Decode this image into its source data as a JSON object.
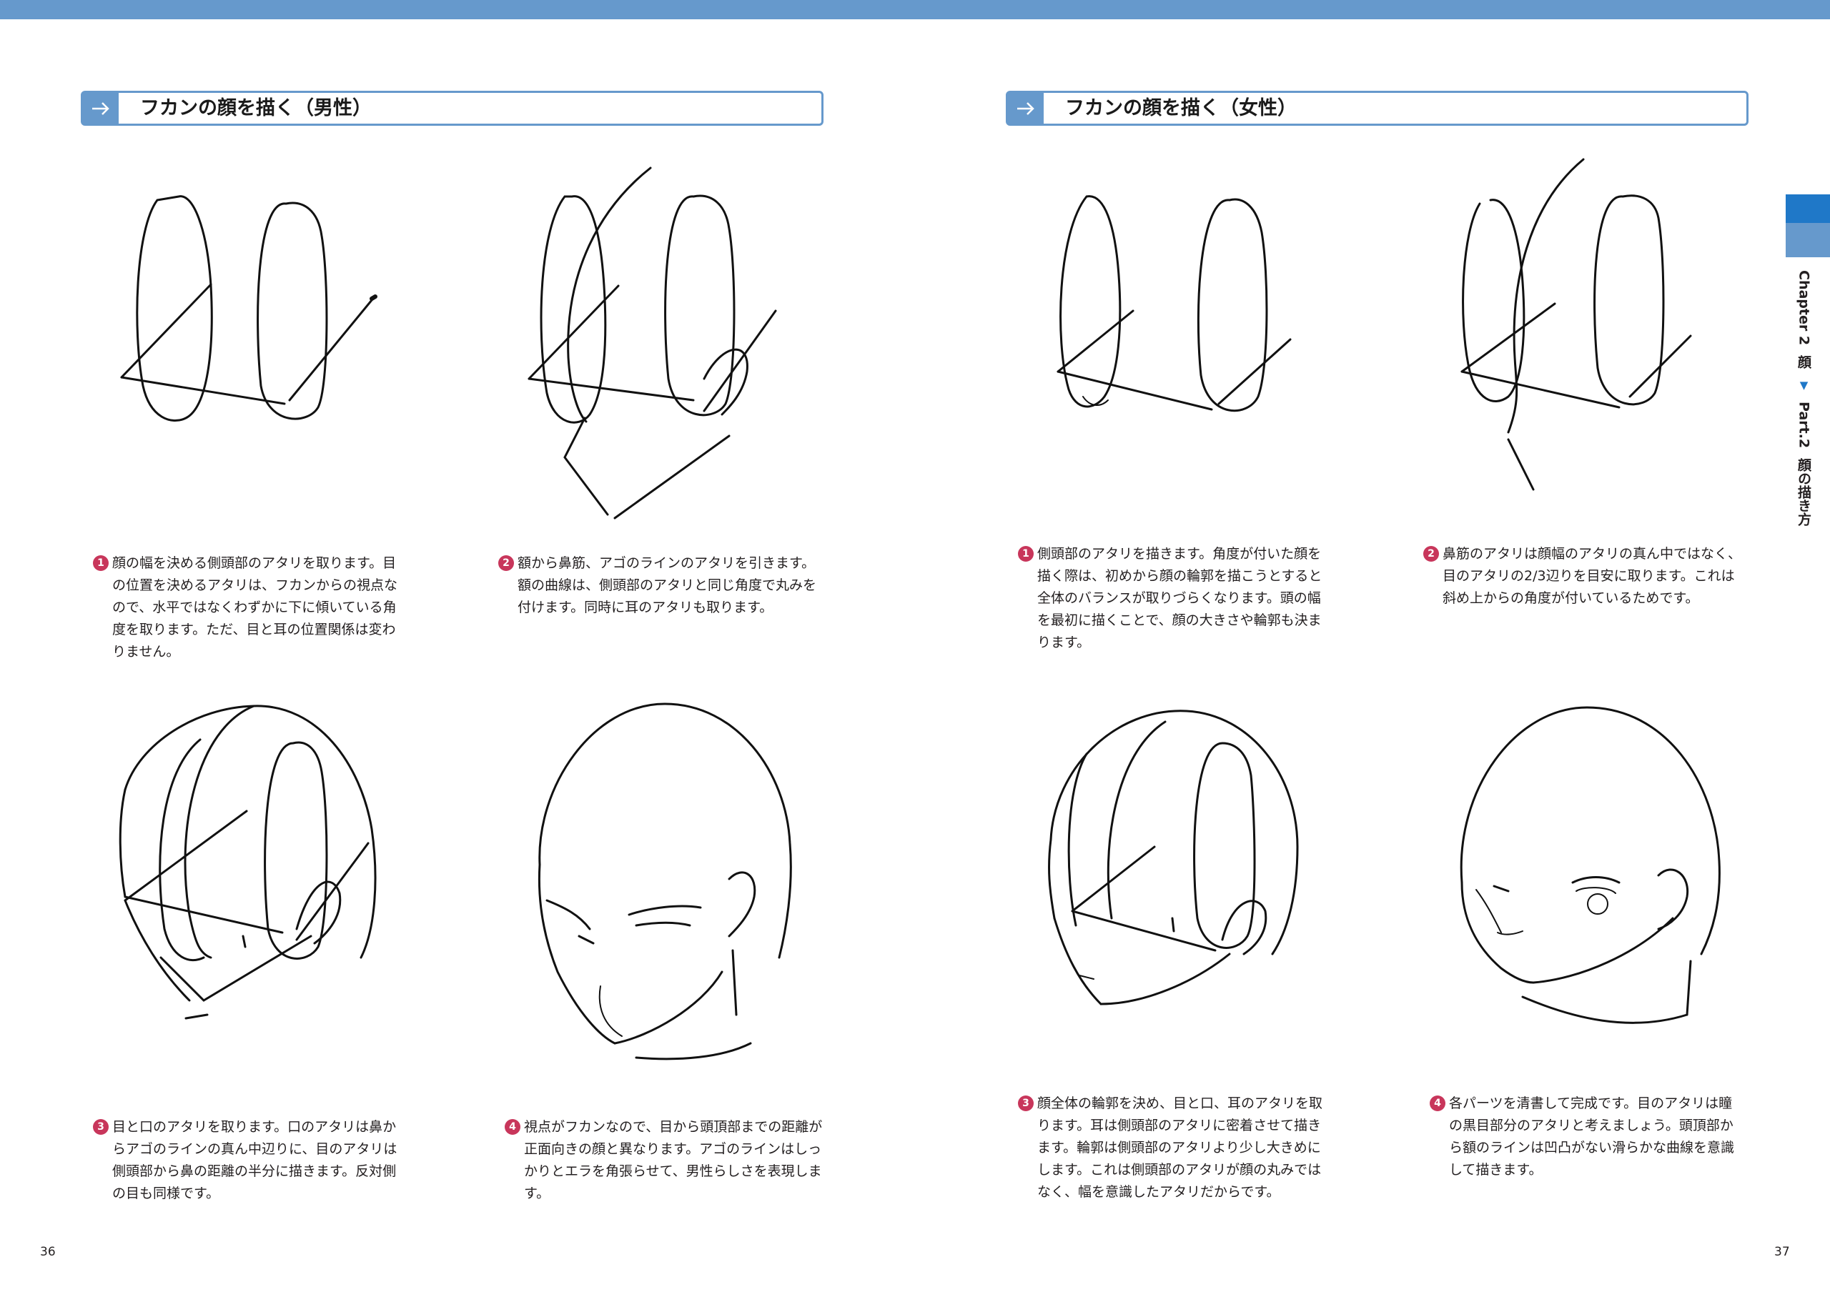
{
  "left_page": {
    "section_title": "フカンの顔を描く（男性）",
    "steps": [
      {
        "num": "1",
        "text": "顔の幅を決める側頭部のアタリを取ります。目の位置を決めるアタリは、フカンからの視点なので、水平ではなくわずかに下に傾いている角度を取ります。ただ、目と耳の位置関係は変わりません。"
      },
      {
        "num": "2",
        "text": "額から鼻筋、アゴのラインのアタリを引きます。額の曲線は、側頭部のアタリと同じ角度で丸みを付けます。同時に耳のアタリも取ります。"
      },
      {
        "num": "3",
        "text": "目と口のアタリを取ります。口のアタリは鼻からアゴのラインの真ん中辺りに、目のアタリは側頭部から鼻の距離の半分に描きます。反対側の目も同様です。"
      },
      {
        "num": "4",
        "text": "視点がフカンなので、目から頭頂部までの距離が正面向きの顔と異なります。アゴのラインはしっかりとエラを角張らせて、男性らしさを表現します。"
      }
    ],
    "page_number": "36"
  },
  "right_page": {
    "section_title": "フカンの顔を描く（女性）",
    "steps": [
      {
        "num": "1",
        "text": "側頭部のアタリを描きます。角度が付いた顔を描く際は、初めから顔の輪郭を描こうとすると全体のバランスが取りづらくなります。頭の幅を最初に描くことで、顔の大きさや輪郭も決まります。"
      },
      {
        "num": "2",
        "text": "鼻筋のアタリは顔幅のアタリの真ん中ではなく、目のアタリの2/3辺りを目安に取ります。これは斜め上からの角度が付いているためです。"
      },
      {
        "num": "3",
        "text": "顔全体の輪郭を決め、目と口、耳のアタリを取ります。耳は側頭部のアタリに密着させて描きます。輪郭は側頭部のアタリより少し大きめにします。これは側頭部のアタリが顔の丸みではなく、幅を意識したアタリだからです。"
      },
      {
        "num": "4",
        "text": "各パーツを清書して完成です。目のアタリは瞳の黒目部分のアタリと考えましょう。頭頂部から額のラインは凹凸がない滑らかな曲線を意識して描きます。"
      }
    ],
    "page_number": "37"
  },
  "side_tab": {
    "chapter": "Chapter 2",
    "chapter_name": "顔",
    "part": "Part.2",
    "part_name": "顔の描き方"
  },
  "colors": {
    "accent": "#6699cc",
    "accent_dark": "#1f78c8",
    "step_badge": "#c8365b"
  },
  "icons": {
    "section_arrow": "arrow-right-icon",
    "breadcrumb_sep": "triangle-down-icon"
  }
}
